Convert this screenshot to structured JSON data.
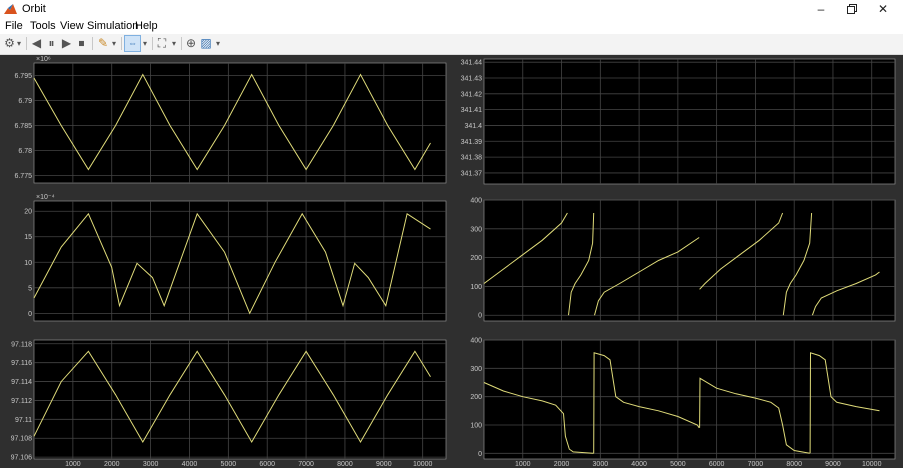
{
  "window": {
    "title": "Orbit"
  },
  "menu": [
    "File",
    "Tools",
    "View",
    "Simulation",
    "Help"
  ],
  "toolbar": {
    "icons": [
      "settings-icon",
      "dropdown-icon",
      "step-back-icon",
      "pause-icon",
      "step-forward-icon",
      "stop-icon",
      "highlight-icon",
      "dropdown-icon",
      "zoom-x-icon",
      "dropdown-icon",
      "zoom-icon",
      "dropdown-icon",
      "autoscale-icon",
      "style-icon",
      "dropdown-icon"
    ]
  },
  "colors": {
    "trace": "#e0dc7a",
    "axes_bg": "#000000",
    "panel_bg": "#2f2f2f",
    "grid": "#454545",
    "tick_text": "#c8c8c8"
  },
  "chart_data": [
    {
      "type": "line",
      "exponent_label": "×10⁶",
      "x_tick_labels": [
        "1000",
        "2000",
        "3000",
        "4000",
        "5000",
        "6000",
        "7000",
        "8000",
        "9000",
        "10000"
      ],
      "y_tick_labels": [
        "6.795",
        "6.79",
        "6.785",
        "6.78",
        "6.775"
      ],
      "y_ticks": [
        6.795,
        6.79,
        6.785,
        6.78,
        6.775
      ],
      "xlim": [
        0,
        10600
      ],
      "ylim": [
        6.7735,
        6.7975
      ],
      "series": [
        {
          "x": [
            0,
            700,
            1400,
            2100,
            2800,
            3500,
            4200,
            4900,
            5600,
            6300,
            7000,
            7700,
            8400,
            9100,
            9800,
            10200
          ],
          "y": [
            6.7945,
            6.785,
            6.7762,
            6.785,
            6.7952,
            6.785,
            6.7762,
            6.785,
            6.7952,
            6.785,
            6.7762,
            6.785,
            6.7952,
            6.785,
            6.7762,
            6.7815
          ]
        }
      ]
    },
    {
      "type": "line",
      "exponent_label": "×10⁻⁴",
      "x_tick_labels": [
        "1000",
        "2000",
        "3000",
        "4000",
        "5000",
        "6000",
        "7000",
        "8000",
        "9000",
        "10000"
      ],
      "y_tick_labels": [
        "20",
        "15",
        "10",
        "5",
        "0"
      ],
      "y_ticks": [
        20,
        15,
        10,
        5,
        0
      ],
      "xlim": [
        0,
        10600
      ],
      "ylim": [
        -1.5,
        22
      ],
      "series": [
        {
          "x": [
            0,
            700,
            1400,
            2000,
            2200,
            2650,
            3050,
            3350,
            3750,
            4200,
            4900,
            5550,
            6200,
            6900,
            7500,
            7950,
            8250,
            8600,
            9050,
            9600,
            10200
          ],
          "y": [
            3,
            13,
            19.5,
            9,
            1.5,
            9.8,
            7,
            1.5,
            10,
            19.5,
            12,
            0,
            10,
            19.5,
            12,
            1.5,
            9.8,
            7,
            1.5,
            19.5,
            16.5
          ]
        }
      ]
    },
    {
      "type": "line",
      "x_tick_labels": [
        "1000",
        "2000",
        "3000",
        "4000",
        "5000",
        "6000",
        "7000",
        "8000",
        "9000",
        "10000"
      ],
      "y_tick_labels": [
        "97.118",
        "97.116",
        "97.114",
        "97.112",
        "97.11",
        "97.108",
        "97.106"
      ],
      "y_ticks": [
        97.118,
        97.116,
        97.114,
        97.112,
        97.11,
        97.108,
        97.106
      ],
      "xlim": [
        0,
        10600
      ],
      "ylim": [
        97.1058,
        97.1184
      ],
      "series": [
        {
          "x": [
            0,
            700,
            1400,
            2100,
            2800,
            3500,
            4200,
            4900,
            5600,
            6300,
            7000,
            7700,
            8400,
            9100,
            9800,
            10200
          ],
          "y": [
            97.1082,
            97.114,
            97.1172,
            97.1126,
            97.1076,
            97.1126,
            97.1172,
            97.1126,
            97.1076,
            97.1126,
            97.1172,
            97.1126,
            97.1076,
            97.1126,
            97.1172,
            97.1145
          ]
        }
      ]
    },
    {
      "type": "line",
      "x_tick_labels": [
        "1000",
        "2000",
        "3000",
        "4000",
        "5000",
        "6000",
        "7000",
        "8000",
        "9000",
        "10000"
      ],
      "y_tick_labels": [
        "341.44",
        "341.43",
        "341.42",
        "341.41",
        "341.4",
        "341.39",
        "341.38",
        "341.37"
      ],
      "y_ticks": [
        341.44,
        341.43,
        341.42,
        341.41,
        341.4,
        341.39,
        341.38,
        341.37
      ],
      "xlim": [
        0,
        10600
      ],
      "ylim": [
        341.363,
        341.442
      ],
      "series": []
    },
    {
      "type": "line",
      "x_tick_labels": [
        "1000",
        "2000",
        "3000",
        "4000",
        "5000",
        "6000",
        "7000",
        "8000",
        "9000",
        "10000"
      ],
      "y_tick_labels": [
        "400",
        "300",
        "200",
        "100",
        "0"
      ],
      "y_ticks": [
        400,
        300,
        200,
        100,
        0
      ],
      "xlim": [
        0,
        10600
      ],
      "ylim": [
        -20,
        400
      ],
      "series": [
        {
          "x": [
            0,
            500,
            1000,
            1500,
            2000,
            2150
          ],
          "y": [
            110,
            160,
            210,
            260,
            320,
            355
          ]
        },
        {
          "x": [
            2180,
            2250,
            2350,
            2500,
            2700,
            2800,
            2830
          ],
          "y": [
            0,
            80,
            110,
            140,
            190,
            250,
            355
          ]
        },
        {
          "x": [
            2850,
            2950,
            3100,
            3500,
            4000,
            4500,
            5000,
            5550
          ],
          "y": [
            0,
            50,
            80,
            110,
            150,
            190,
            220,
            270
          ]
        },
        {
          "x": [
            5560,
            5700,
            6100,
            6600,
            7100,
            7600,
            7700
          ],
          "y": [
            90,
            110,
            160,
            210,
            260,
            320,
            355
          ]
        },
        {
          "x": [
            7720,
            7800,
            7900,
            8050,
            8250,
            8400,
            8450
          ],
          "y": [
            0,
            80,
            110,
            140,
            190,
            250,
            355
          ]
        },
        {
          "x": [
            8470,
            8550,
            8700,
            9100,
            9600,
            10100,
            10200
          ],
          "y": [
            0,
            30,
            60,
            85,
            110,
            140,
            150
          ]
        }
      ]
    },
    {
      "type": "line",
      "x_tick_labels": [
        "1000",
        "2000",
        "3000",
        "4000",
        "5000",
        "6000",
        "7000",
        "8000",
        "9000",
        "10000"
      ],
      "y_tick_labels": [
        "400",
        "300",
        "200",
        "100",
        "0"
      ],
      "y_ticks": [
        400,
        300,
        200,
        100,
        0
      ],
      "xlim": [
        0,
        10600
      ],
      "ylim": [
        -20,
        400
      ],
      "series": [
        {
          "x": [
            0,
            500,
            1000,
            1500,
            1850,
            2050,
            2100,
            2200,
            2300,
            2800,
            2830
          ],
          "y": [
            250,
            220,
            200,
            185,
            170,
            140,
            60,
            15,
            5,
            0,
            0
          ]
        },
        {
          "x": [
            2830,
            2840,
            3100,
            3250,
            3400,
            3600,
            4000,
            4500,
            5000,
            5500,
            5550
          ],
          "y": [
            0,
            355,
            345,
            330,
            200,
            180,
            165,
            150,
            130,
            100,
            90
          ]
        },
        {
          "x": [
            5560,
            5570,
            6000,
            6500,
            7000,
            7400,
            7600,
            7700,
            7800,
            8000,
            8400
          ],
          "y": [
            90,
            265,
            230,
            210,
            195,
            180,
            160,
            100,
            30,
            10,
            0
          ]
        },
        {
          "x": [
            8410,
            8420,
            8650,
            8800,
            8950,
            9100,
            9600,
            10200
          ],
          "y": [
            0,
            355,
            345,
            330,
            200,
            180,
            165,
            150
          ]
        }
      ]
    }
  ]
}
